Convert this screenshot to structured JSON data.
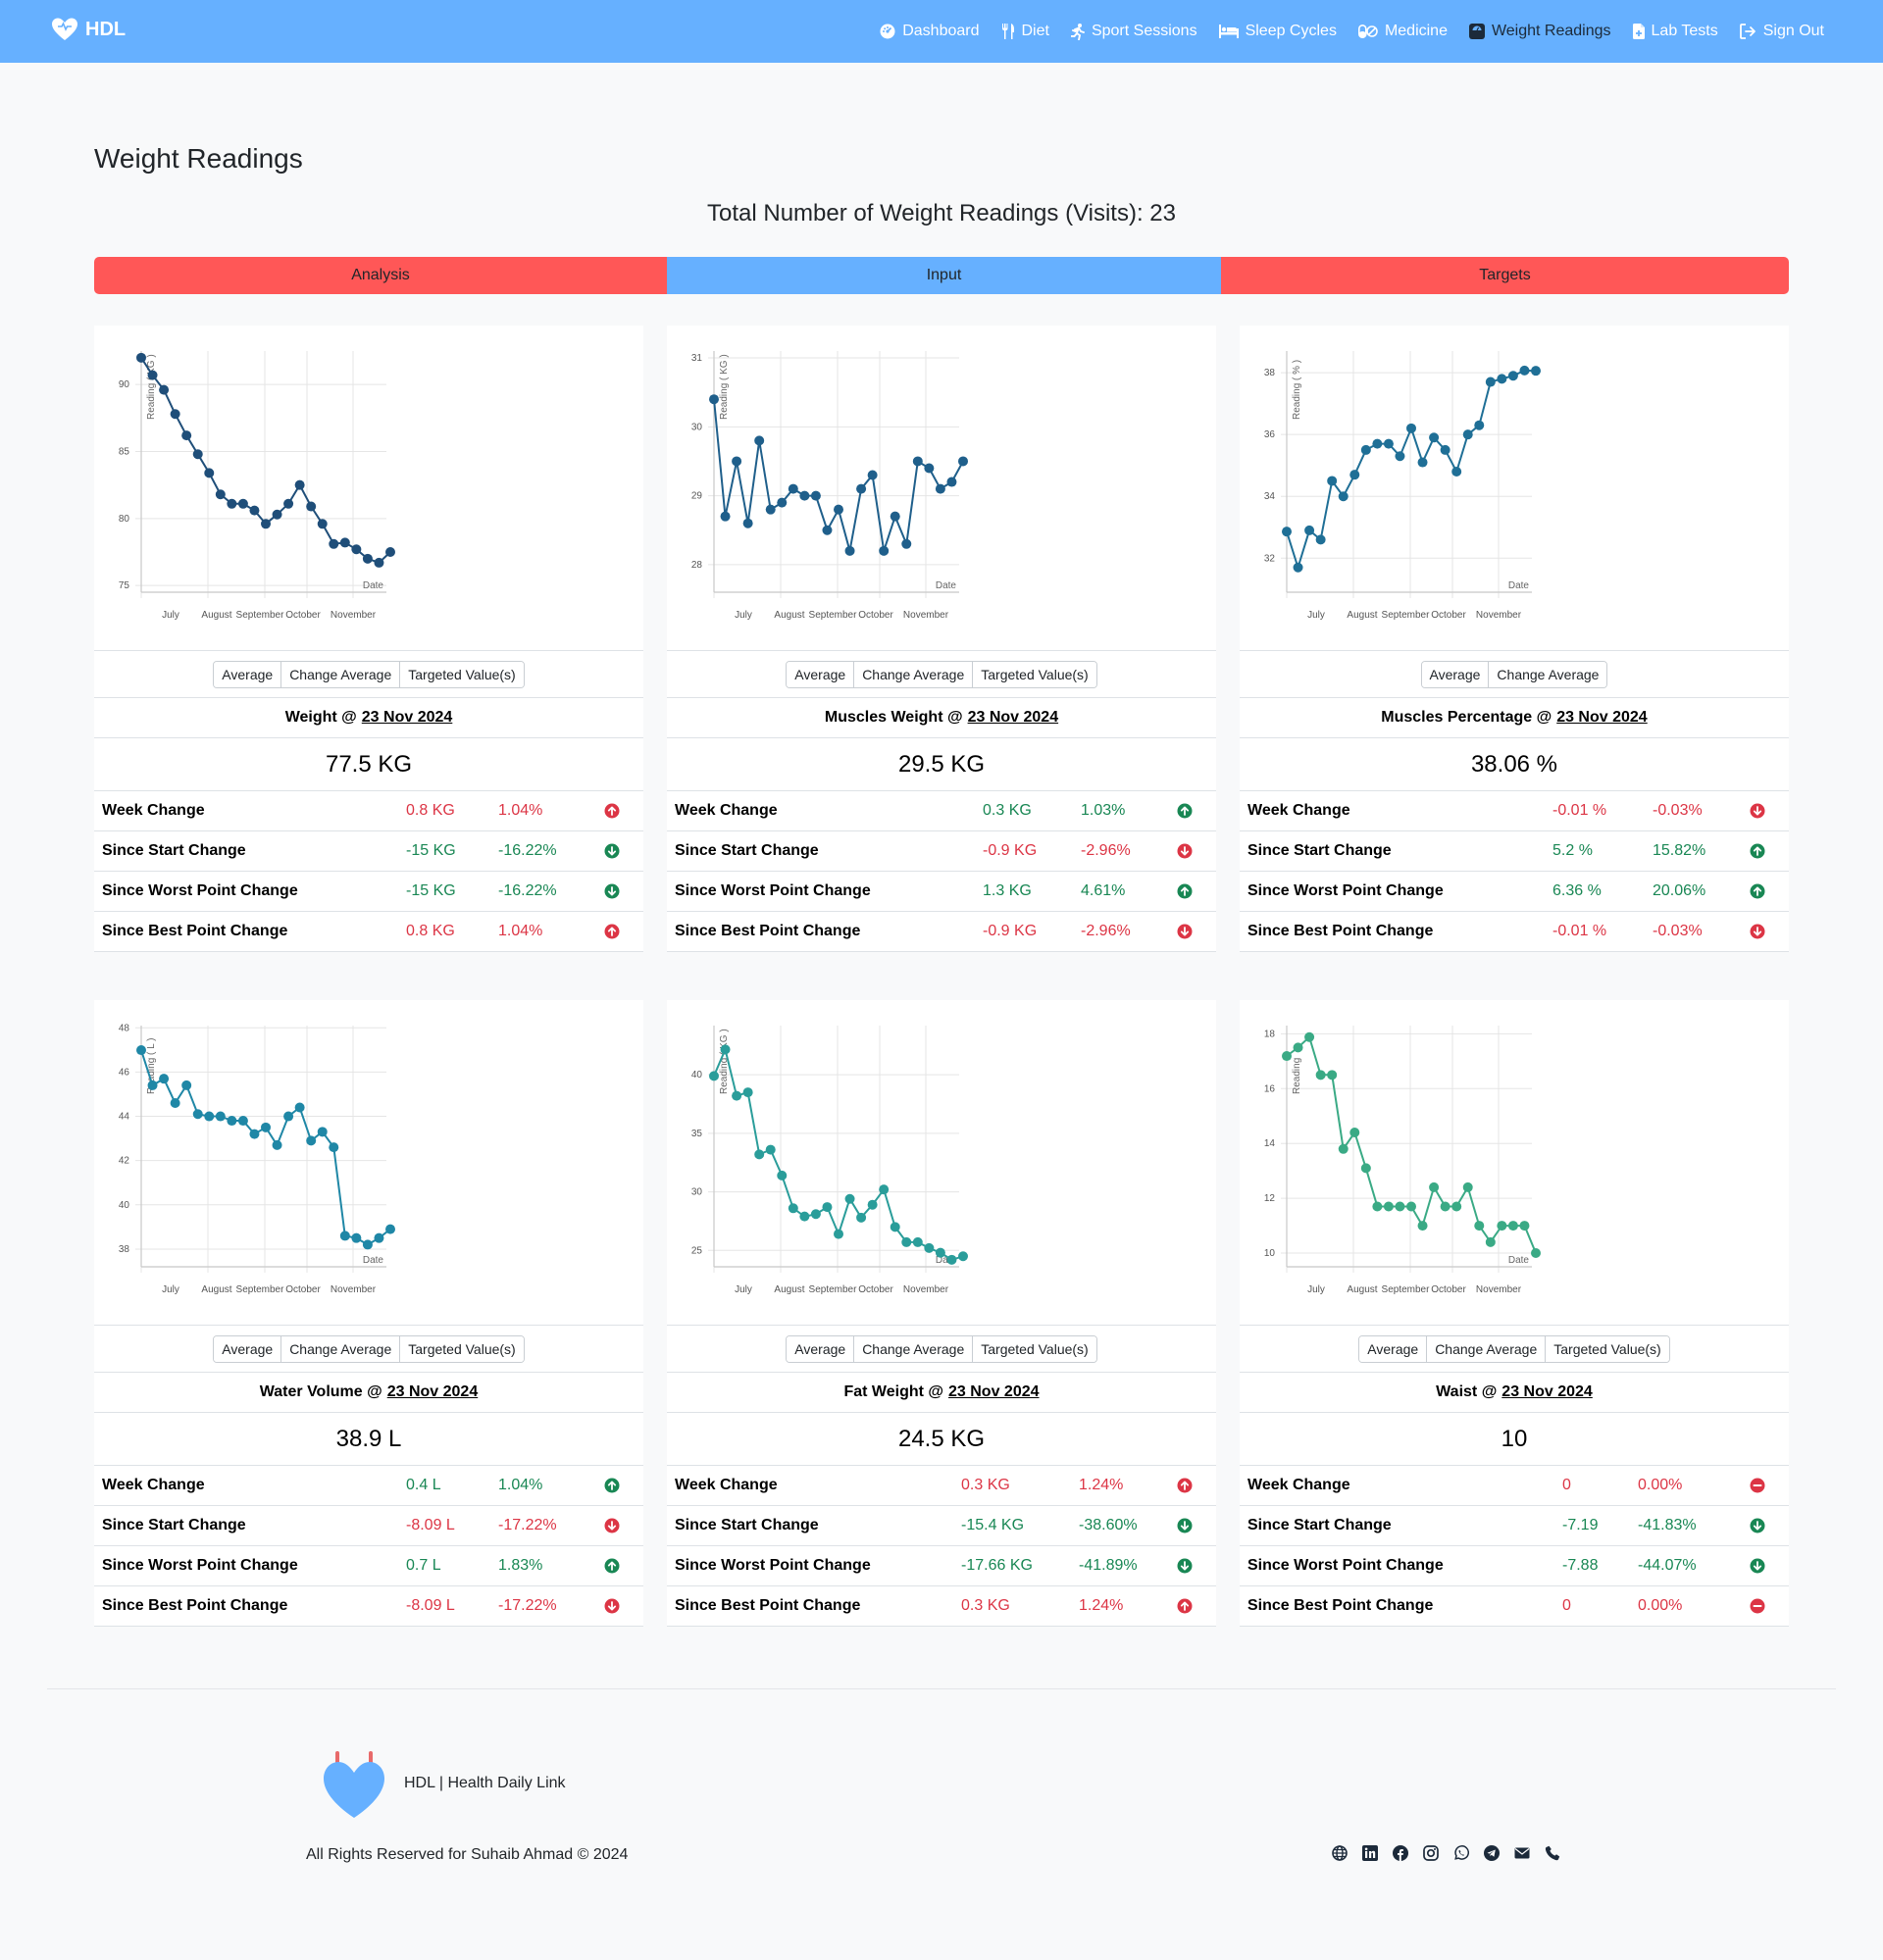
{
  "brand": {
    "name": "HDL"
  },
  "nav": [
    {
      "label": "Dashboard",
      "icon": "dashboard-icon"
    },
    {
      "label": "Diet",
      "icon": "utensils-icon"
    },
    {
      "label": "Sport Sessions",
      "icon": "running-icon"
    },
    {
      "label": "Sleep Cycles",
      "icon": "bed-icon"
    },
    {
      "label": "Medicine",
      "icon": "pills-icon"
    },
    {
      "label": "Weight Readings",
      "icon": "scale-icon"
    },
    {
      "label": "Lab Tests",
      "icon": "file-medical-icon"
    },
    {
      "label": "Sign Out",
      "icon": "sign-out-icon"
    }
  ],
  "page": {
    "title": "Weight Readings",
    "total": "Total Number of Weight Readings (Visits): 23"
  },
  "tabs": {
    "analysis": "Analysis",
    "input": "Input",
    "targets": "Targets"
  },
  "colors": {
    "up_bad": "#dc3545",
    "down_good": "#198754",
    "neutral": "#dc3545"
  },
  "cards": [
    {
      "buttons": [
        "Average",
        "Change Average",
        "Targeted Value(s)"
      ],
      "title": "Weight @",
      "date": "23 Nov 2024",
      "value": "77.5 KG",
      "stats": [
        {
          "label": "Week Change",
          "abs": "0.8 KG",
          "pct": "1.04%",
          "color": "red",
          "dir": "up"
        },
        {
          "label": "Since Start Change",
          "abs": "-15 KG",
          "pct": "-16.22%",
          "color": "green",
          "dir": "down"
        },
        {
          "label": "Since Worst Point Change",
          "abs": "-15 KG",
          "pct": "-16.22%",
          "color": "green",
          "dir": "down"
        },
        {
          "label": "Since Best Point Change",
          "abs": "0.8 KG",
          "pct": "1.04%",
          "color": "red",
          "dir": "up"
        }
      ]
    },
    {
      "buttons": [
        "Average",
        "Change Average",
        "Targeted Value(s)"
      ],
      "title": "Muscles Weight @",
      "date": "23 Nov 2024",
      "value": "29.5 KG",
      "stats": [
        {
          "label": "Week Change",
          "abs": "0.3 KG",
          "pct": "1.03%",
          "color": "green",
          "dir": "up"
        },
        {
          "label": "Since Start Change",
          "abs": "-0.9 KG",
          "pct": "-2.96%",
          "color": "red",
          "dir": "down"
        },
        {
          "label": "Since Worst Point Change",
          "abs": "1.3 KG",
          "pct": "4.61%",
          "color": "green",
          "dir": "up"
        },
        {
          "label": "Since Best Point Change",
          "abs": "-0.9 KG",
          "pct": "-2.96%",
          "color": "red",
          "dir": "down"
        }
      ]
    },
    {
      "buttons": [
        "Average",
        "Change Average"
      ],
      "title": "Muscles Percentage @",
      "date": "23 Nov 2024",
      "value": "38.06 %",
      "stats": [
        {
          "label": "Week Change",
          "abs": "-0.01 %",
          "pct": "-0.03%",
          "color": "red",
          "dir": "down"
        },
        {
          "label": "Since Start Change",
          "abs": "5.2 %",
          "pct": "15.82%",
          "color": "green",
          "dir": "up"
        },
        {
          "label": "Since Worst Point Change",
          "abs": "6.36 %",
          "pct": "20.06%",
          "color": "green",
          "dir": "up"
        },
        {
          "label": "Since Best Point Change",
          "abs": "-0.01 %",
          "pct": "-0.03%",
          "color": "red",
          "dir": "down"
        }
      ]
    },
    {
      "buttons": [
        "Average",
        "Change Average",
        "Targeted Value(s)"
      ],
      "title": "Water Volume @",
      "date": "23 Nov 2024",
      "value": "38.9 L",
      "stats": [
        {
          "label": "Week Change",
          "abs": "0.4 L",
          "pct": "1.04%",
          "color": "green",
          "dir": "up"
        },
        {
          "label": "Since Start Change",
          "abs": "-8.09 L",
          "pct": "-17.22%",
          "color": "red",
          "dir": "down"
        },
        {
          "label": "Since Worst Point Change",
          "abs": "0.7 L",
          "pct": "1.83%",
          "color": "green",
          "dir": "up"
        },
        {
          "label": "Since Best Point Change",
          "abs": "-8.09 L",
          "pct": "-17.22%",
          "color": "red",
          "dir": "down"
        }
      ]
    },
    {
      "buttons": [
        "Average",
        "Change Average",
        "Targeted Value(s)"
      ],
      "title": "Fat Weight @",
      "date": "23 Nov 2024",
      "value": "24.5 KG",
      "stats": [
        {
          "label": "Week Change",
          "abs": "0.3 KG",
          "pct": "1.24%",
          "color": "red",
          "dir": "up"
        },
        {
          "label": "Since Start Change",
          "abs": "-15.4 KG",
          "pct": "-38.60%",
          "color": "green",
          "dir": "down"
        },
        {
          "label": "Since Worst Point Change",
          "abs": "-17.66 KG",
          "pct": "-41.89%",
          "color": "green",
          "dir": "down"
        },
        {
          "label": "Since Best Point Change",
          "abs": "0.3 KG",
          "pct": "1.24%",
          "color": "red",
          "dir": "up"
        }
      ]
    },
    {
      "buttons": [
        "Average",
        "Change Average",
        "Targeted Value(s)"
      ],
      "title": "Waist @",
      "date": "23 Nov 2024",
      "value": "10",
      "stats": [
        {
          "label": "Week Change",
          "abs": "0",
          "pct": "0.00%",
          "color": "red",
          "dir": "flat"
        },
        {
          "label": "Since Start Change",
          "abs": "-7.19",
          "pct": "-41.83%",
          "color": "green",
          "dir": "down"
        },
        {
          "label": "Since Worst Point Change",
          "abs": "-7.88",
          "pct": "-44.07%",
          "color": "green",
          "dir": "down"
        },
        {
          "label": "Since Best Point Change",
          "abs": "0",
          "pct": "0.00%",
          "color": "red",
          "dir": "flat"
        }
      ]
    }
  ],
  "chart_data": [
    {
      "type": "line",
      "ylabel": "Reading ( KG )",
      "xlabel": "Date",
      "color": "#1f4e79",
      "x_ticks": [
        "July",
        "August",
        "September",
        "October",
        "November"
      ],
      "y_ticks": [
        75,
        80,
        85,
        90
      ],
      "ylim": [
        74.5,
        92.5
      ],
      "values": [
        92,
        90.7,
        89.6,
        87.8,
        86.2,
        84.8,
        83.4,
        81.8,
        81.1,
        81.1,
        80.6,
        79.6,
        80.3,
        81.1,
        82.5,
        80.9,
        79.6,
        78.1,
        78.2,
        77.7,
        77,
        76.7,
        77.5
      ]
    },
    {
      "type": "line",
      "ylabel": "Reading ( KG )",
      "xlabel": "Date",
      "color": "#1f5f8b",
      "x_ticks": [
        "July",
        "August",
        "September",
        "October",
        "November"
      ],
      "y_ticks": [
        28,
        29,
        30,
        31
      ],
      "ylim": [
        27.6,
        31.1
      ],
      "values": [
        30.4,
        28.7,
        29.5,
        28.6,
        29.8,
        28.8,
        28.9,
        29.1,
        29,
        29.0,
        28.5,
        28.8,
        28.2,
        29.1,
        29.3,
        28.2,
        28.7,
        28.3,
        29.5,
        29.4,
        29.1,
        29.2,
        29.5
      ]
    },
    {
      "type": "line",
      "ylabel": "Reading ( % )",
      "xlabel": "Date",
      "color": "#1f6f96",
      "x_ticks": [
        "July",
        "August",
        "September",
        "October",
        "November"
      ],
      "y_ticks": [
        32,
        34,
        36,
        38
      ],
      "ylim": [
        30.9,
        38.7
      ],
      "values": [
        32.86,
        31.7,
        32.9,
        32.6,
        34.5,
        34,
        34.7,
        35.5,
        35.7,
        35.7,
        35.3,
        36.2,
        35.1,
        35.9,
        35.5,
        34.8,
        36,
        36.3,
        37.7,
        37.8,
        37.9,
        38.07,
        38.06
      ]
    },
    {
      "type": "line",
      "ylabel": "Reading ( L )",
      "xlabel": "Date",
      "color": "#1f87a6",
      "x_ticks": [
        "July",
        "August",
        "September",
        "October",
        "November"
      ],
      "y_ticks": [
        38,
        40,
        42,
        44,
        46,
        48
      ],
      "ylim": [
        37.2,
        48.1
      ],
      "values": [
        46.99,
        45.4,
        45.7,
        44.6,
        45.4,
        44.1,
        44,
        44,
        43.8,
        43.8,
        43.2,
        43.5,
        42.7,
        44,
        44.4,
        42.9,
        43.3,
        42.6,
        38.6,
        38.5,
        38.2,
        38.5,
        38.9
      ]
    },
    {
      "type": "line",
      "ylabel": "Reading ( KG )",
      "xlabel": "Date",
      "color": "#2a9d9a",
      "x_ticks": [
        "July",
        "August",
        "September",
        "October",
        "November"
      ],
      "y_ticks": [
        25,
        30,
        35,
        40
      ],
      "ylim": [
        23.6,
        44.2
      ],
      "values": [
        39.9,
        42.16,
        38.2,
        38.5,
        33.2,
        33.6,
        31.4,
        28.6,
        27.9,
        28.1,
        28.7,
        26.4,
        29.4,
        27.8,
        28.9,
        30.2,
        27,
        25.7,
        25.7,
        25.2,
        24.8,
        24.2,
        24.5
      ]
    },
    {
      "type": "line",
      "ylabel": "Reading",
      "xlabel": "Date",
      "color": "#3aaa85",
      "x_ticks": [
        "July",
        "August",
        "September",
        "October",
        "November"
      ],
      "y_ticks": [
        10,
        12,
        14,
        16,
        18
      ],
      "ylim": [
        9.5,
        18.3
      ],
      "values": [
        17.19,
        17.5,
        17.88,
        16.5,
        16.5,
        13.8,
        14.4,
        13.1,
        11.7,
        11.7,
        11.7,
        11.7,
        11.0,
        12.4,
        11.7,
        11.7,
        12.4,
        11,
        10.4,
        11,
        11,
        11,
        10
      ]
    }
  ],
  "footer": {
    "name": "HDL | Health Daily Link",
    "copyright": "All Rights Reserved for Suhaib Ahmad © 2024",
    "socials": [
      "globe-icon",
      "linkedin-icon",
      "facebook-icon",
      "instagram-icon",
      "whatsapp-icon",
      "telegram-icon",
      "envelope-icon",
      "phone-icon"
    ]
  }
}
